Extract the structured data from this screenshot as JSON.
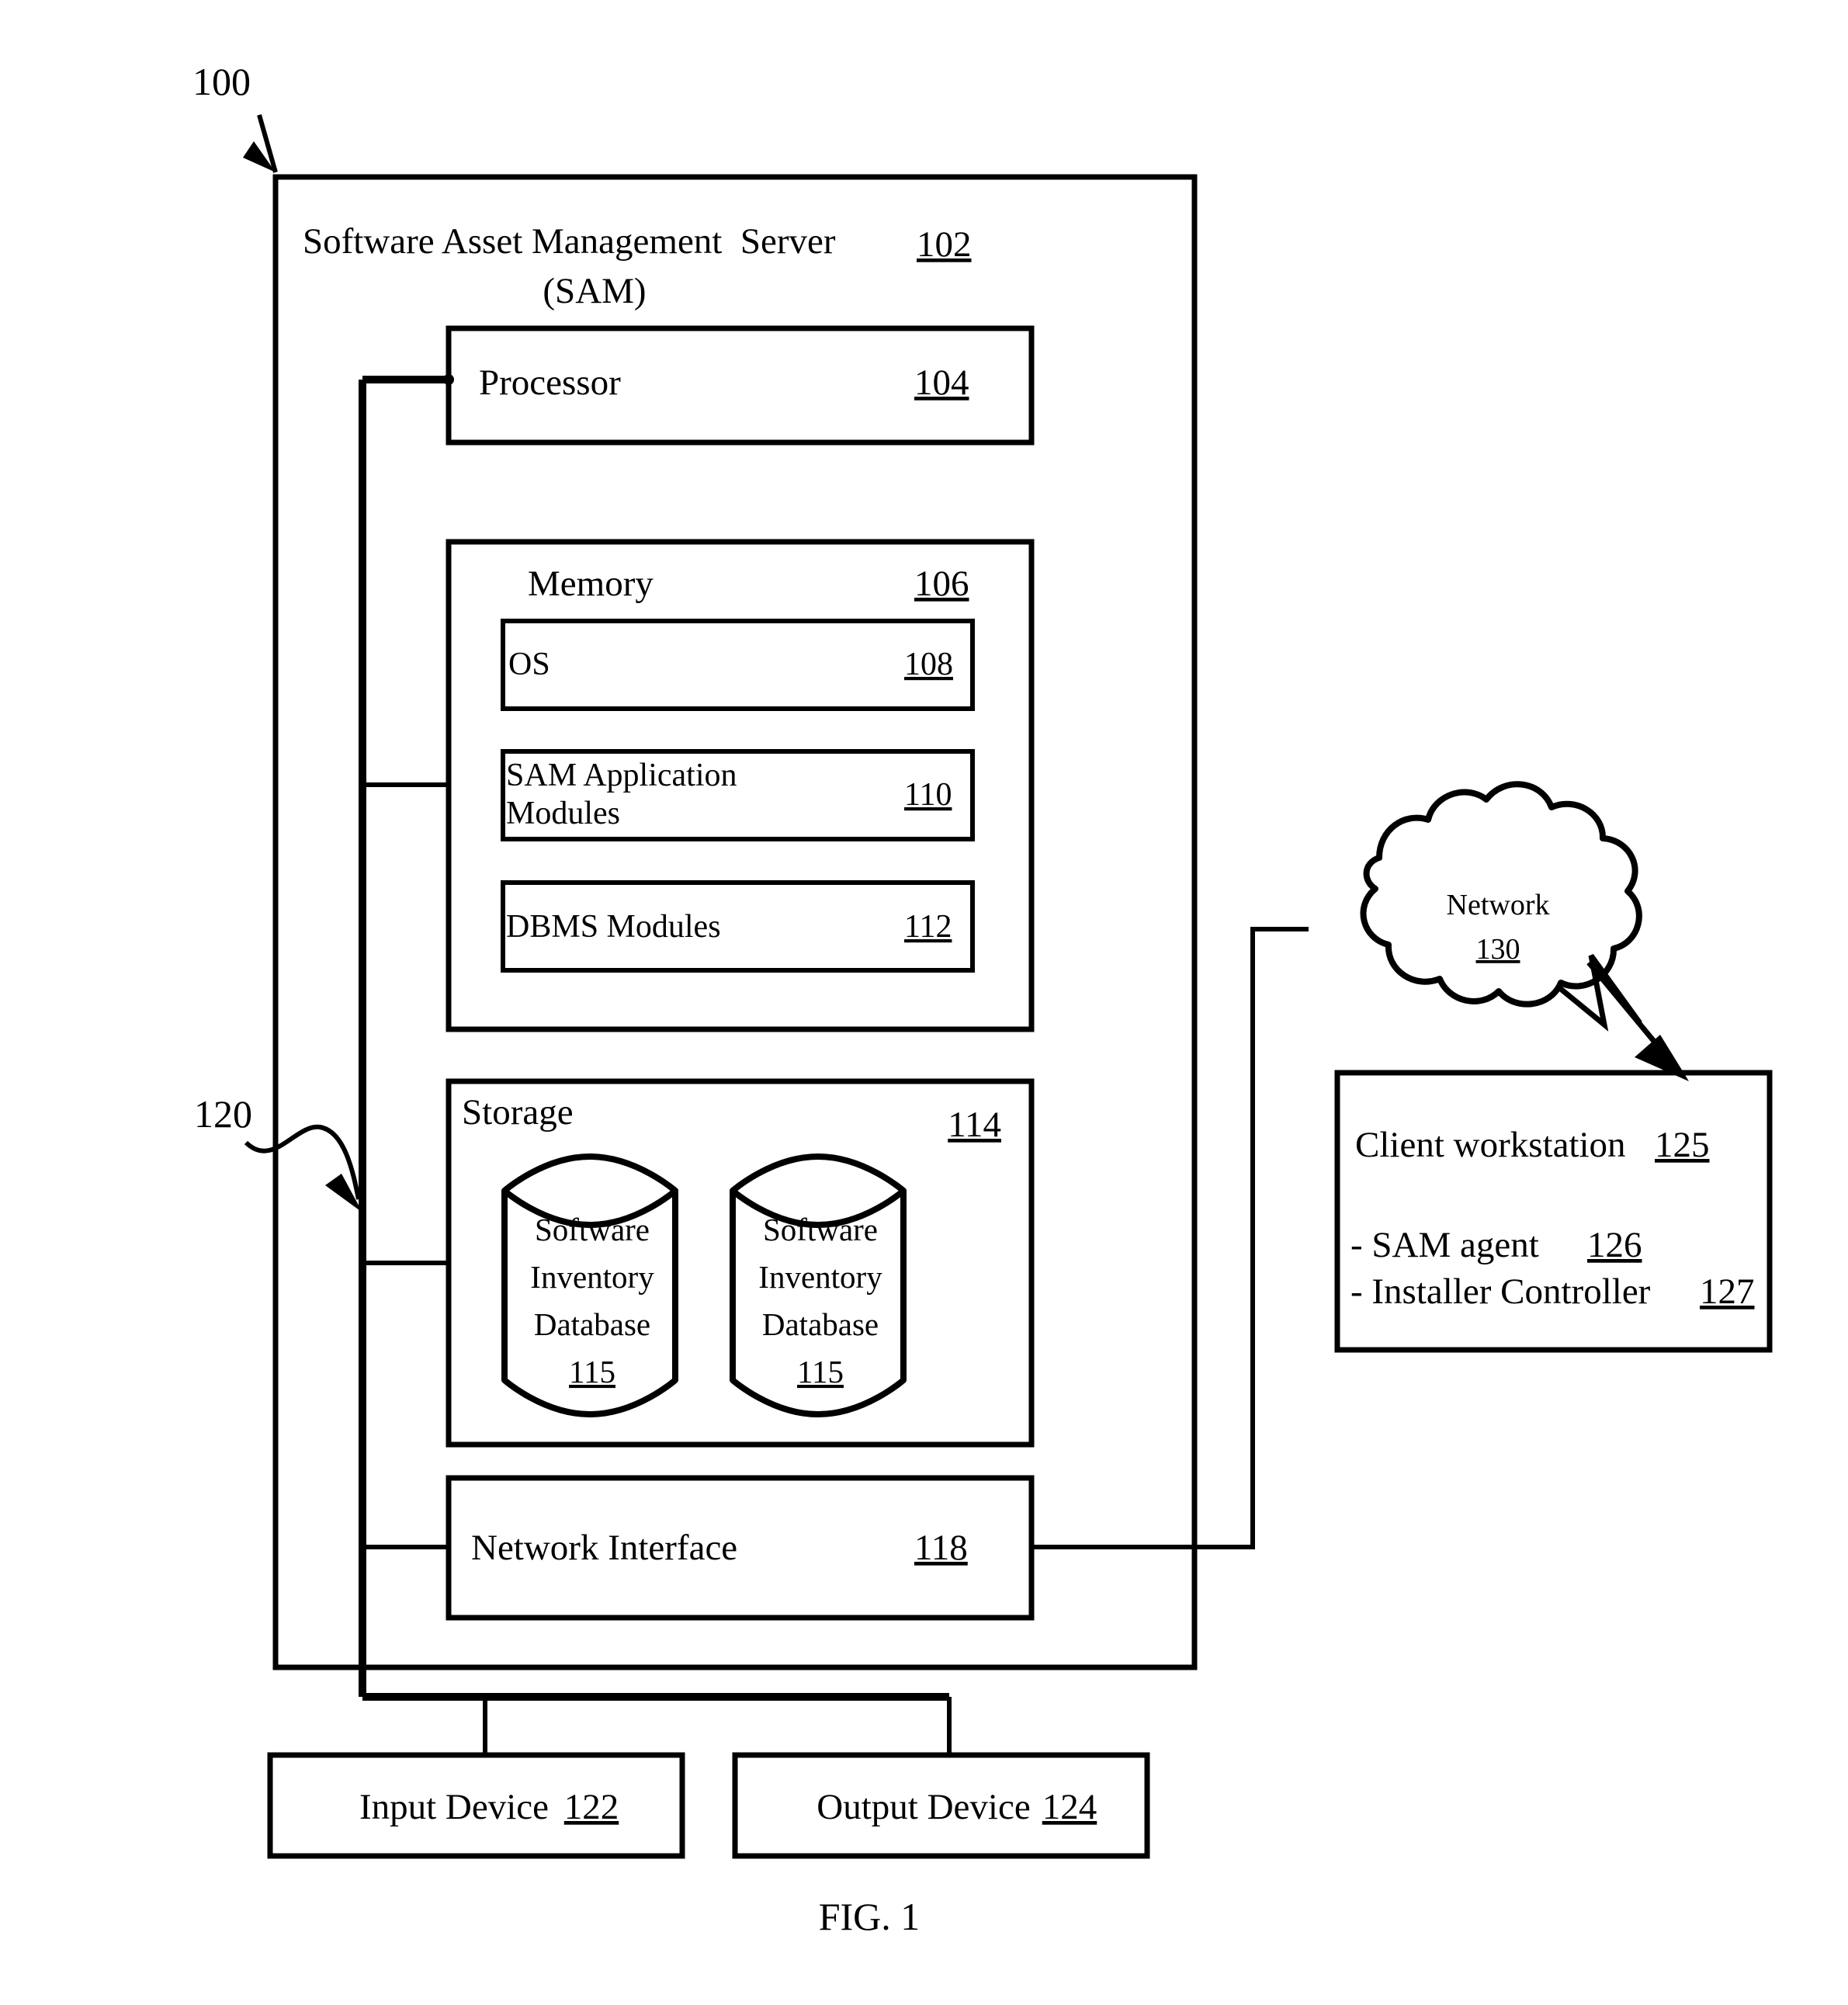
{
  "figure": {
    "caption": "FIG. 1",
    "system_ref": "100",
    "bus_ref": "120"
  },
  "server": {
    "title_line1": "Software Asset Management  Server",
    "title_line2": "(SAM)",
    "ref": "102"
  },
  "processor": {
    "label": "Processor",
    "ref": "104"
  },
  "memory": {
    "label": "Memory",
    "ref": "106",
    "modules": [
      {
        "label": "OS",
        "label_line2": "",
        "ref": "108"
      },
      {
        "label": "SAM Application",
        "label_line2": "Modules",
        "ref": "110"
      },
      {
        "label": "DBMS Modules",
        "label_line2": "",
        "ref": "112"
      }
    ]
  },
  "storage": {
    "label": "Storage",
    "ref": "114",
    "databases": [
      {
        "line1": "Software",
        "line2": "Inventory",
        "line3": "Database",
        "ref": "115"
      },
      {
        "line1": "Software",
        "line2": "Inventory",
        "line3": "Database",
        "ref": "115"
      }
    ]
  },
  "network_interface": {
    "label": "Network Interface",
    "ref": "118"
  },
  "network_cloud": {
    "label": "Network",
    "ref": "130"
  },
  "client": {
    "title": "Client workstation",
    "title_ref": "125",
    "items": [
      {
        "label": "- SAM agent",
        "ref": "126"
      },
      {
        "label": "- Installer Controller",
        "ref": "127"
      }
    ]
  },
  "peripherals": [
    {
      "label": "Input Device",
      "ref": "122"
    },
    {
      "label": "Output Device",
      "ref": "124"
    }
  ],
  "colors": {
    "stroke": "#000000",
    "background": "#ffffff"
  }
}
